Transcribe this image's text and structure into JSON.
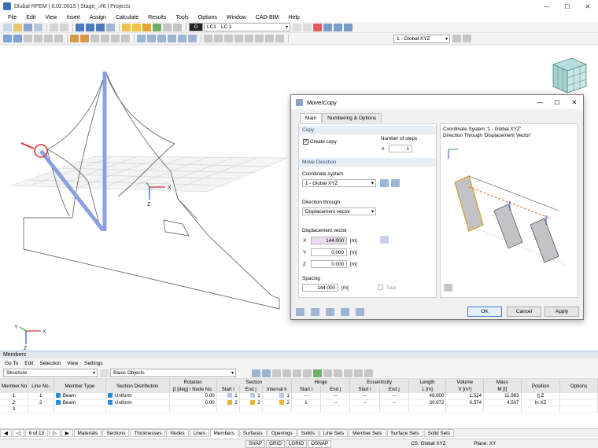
{
  "app": {
    "title": "Dlubal RFEM | 6.02.0015 | Stage_.rf6 | Projects"
  },
  "menu": [
    "File",
    "Edit",
    "View",
    "Insert",
    "Assign",
    "Calculate",
    "Results",
    "Tools",
    "Options",
    "Window",
    "CAD-BIM",
    "Help"
  ],
  "toolbar": {
    "lc_tag": "G",
    "lc_id": "LC1",
    "lc_name": "LC 1",
    "coord_system": "1 - Global XYZ"
  },
  "axes": {
    "x": "X",
    "z": "Z",
    "y": "Y"
  },
  "dialog": {
    "title": "Move/Copy",
    "tabs": [
      "Main",
      "Numbering & Options"
    ],
    "copy": {
      "header": "Copy",
      "create_copy_label": "Create copy",
      "create_copy_checked": true,
      "steps_label": "Number of steps",
      "steps_symbol": "n",
      "steps_value": "1"
    },
    "move": {
      "header": "Move Direction",
      "coord_label": "Coordinate system",
      "coord_value": "1 - Global XYZ",
      "direction_label": "Direction through",
      "direction_value": "Displacement vector",
      "vector_label": "Displacement vector",
      "x_label": "X",
      "x_value": "144.000",
      "y_label": "Y",
      "y_value": "0.000",
      "z_label": "Z",
      "z_value": "0.000",
      "unit": "[m]",
      "spacing_label": "Spacing",
      "spacing_value": "144.000",
      "total_label": "Total"
    },
    "preview": {
      "line1": "Coordinate System '1 - Global XYZ'",
      "line2": "Direction Through 'Displacement Vector'"
    },
    "buttons": {
      "ok": "OK",
      "cancel": "Cancel",
      "apply": "Apply"
    }
  },
  "members": {
    "title": "Members",
    "menu": [
      "Go To",
      "Edit",
      "Selection",
      "View",
      "Settings"
    ],
    "structure_combo": "Structure",
    "objects_combo": "Basic Objects",
    "group_headers": {
      "rotation": "Rotation",
      "section": "Section",
      "hinge": "Hinge",
      "eccentricity": "Eccentricity",
      "length": "Length",
      "volume": "Volume",
      "mass": "Mass"
    },
    "headers": [
      "Member No.",
      "Line No.",
      "Member Type",
      "Section Distribution",
      "β [deg] / Node No.",
      "Start i",
      "End j",
      "Internal k",
      "Start i",
      "End j",
      "Start i",
      "End j",
      "L [m]",
      "V [m³]",
      "M [t]",
      "Position",
      "Options"
    ],
    "rows": [
      {
        "no": "1",
        "line": "1",
        "type": "Beam",
        "type_color": "#2b8fd8",
        "dist": "Uniform",
        "dist_color": "#2b8fd8",
        "rot": "0.00",
        "s_start": "1",
        "s_end": "1",
        "s_int": "1",
        "h_start": "--",
        "h_end": "--",
        "e_start": "--",
        "e_end": "--",
        "length": "49.000",
        "volume": "1.524",
        "mass": "11.963",
        "position": "|| Z",
        "options": ""
      },
      {
        "no": "2",
        "line": "2",
        "type": "Beam",
        "type_color": "#2b8fd8",
        "dist": "Uniform",
        "dist_color": "#2b8fd8",
        "rot": "0.00",
        "s_start": "2",
        "s_end": "2",
        "s_int": "2",
        "h_start": "1",
        "h_end": "--",
        "e_start": "--",
        "e_end": "--",
        "length": "30.972",
        "volume": "0.574",
        "mass": "4.507",
        "position": "In XZ",
        "options": ""
      },
      {
        "no": "3",
        "line": "",
        "type": "",
        "type_color": "",
        "dist": "",
        "dist_color": "",
        "rot": "",
        "s_start": "",
        "s_end": "",
        "s_int": "",
        "h_start": "",
        "h_end": "",
        "e_start": "",
        "e_end": "",
        "length": "",
        "volume": "",
        "mass": "",
        "position": "",
        "options": ""
      }
    ],
    "pager": "6 of 13",
    "tabs": [
      "Materials",
      "Sections",
      "Thicknesses",
      "Nodes",
      "Lines",
      "Members",
      "Surfaces",
      "Openings",
      "Solids",
      "Line Sets",
      "Member Sets",
      "Surface Sets",
      "Solid Sets"
    ],
    "active_tab": "Members"
  },
  "status": {
    "buttons": [
      "SNAP",
      "GRID",
      "LGRID",
      "OSNAP"
    ],
    "cs": "CS: Global XYZ",
    "plane": "Plane: XY"
  }
}
